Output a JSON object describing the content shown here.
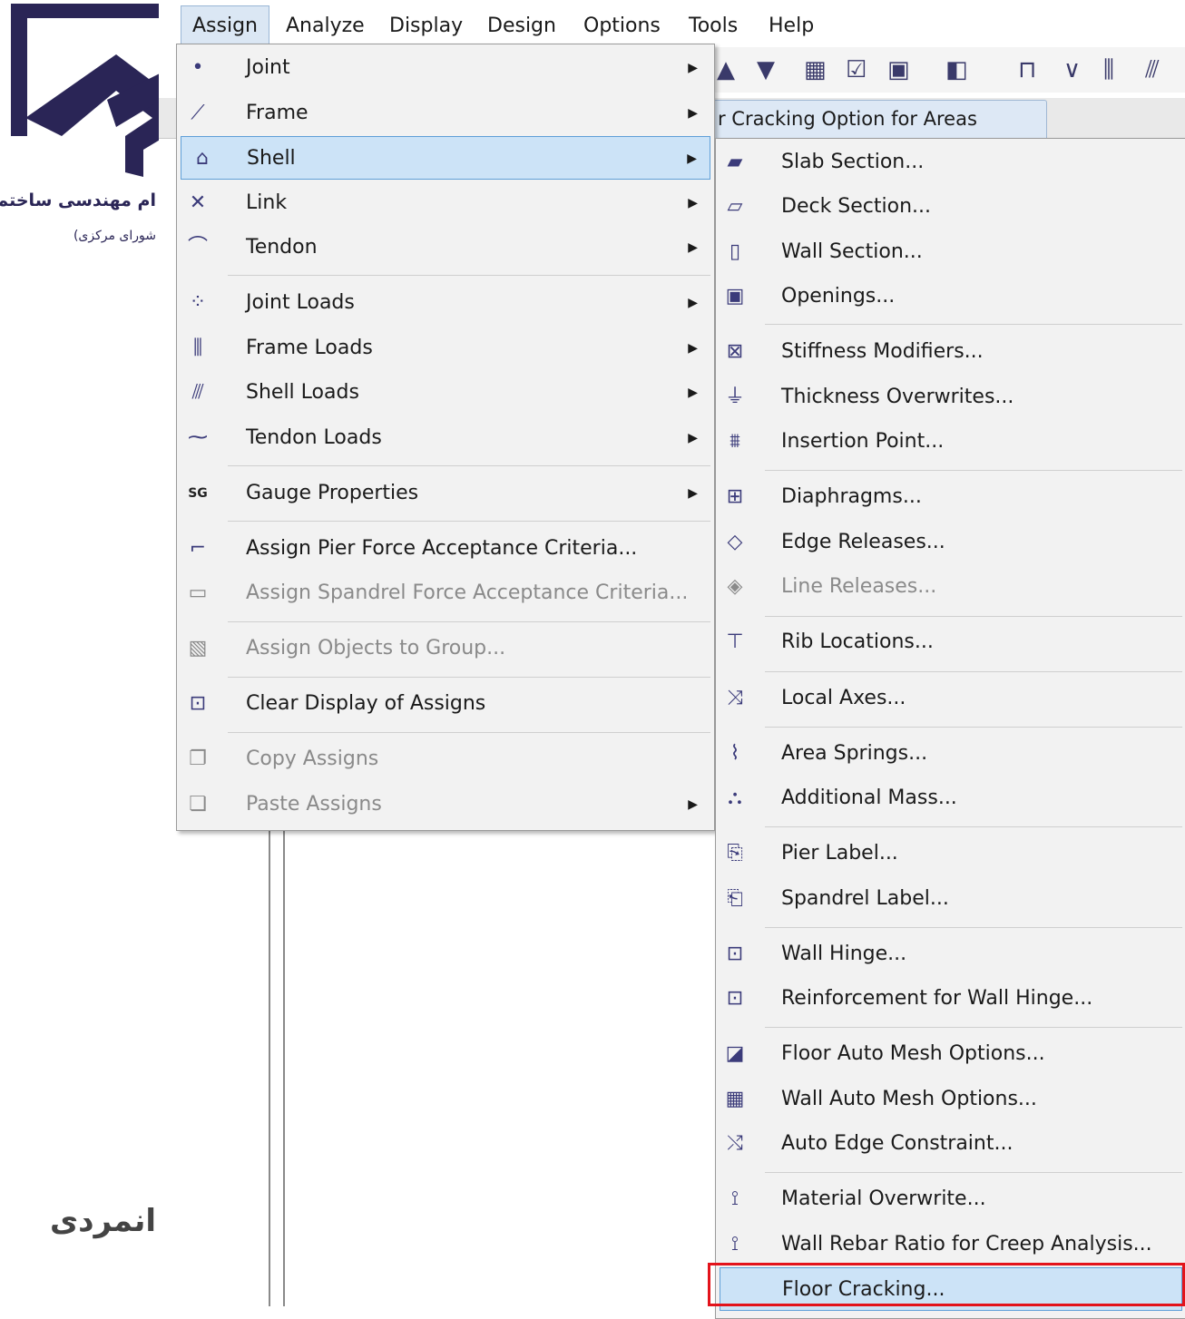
{
  "watermark": {
    "org_line1": "ام مهندسی ساختمان",
    "org_line2": "شورای مرکزی)",
    "author": "انمردی"
  },
  "menubar": {
    "items": [
      "Assign",
      "Analyze",
      "Display",
      "Design",
      "Options",
      "Tools",
      "Help"
    ],
    "active": "Assign"
  },
  "tab": {
    "label": "r Cracking Option for Areas"
  },
  "assign_menu": {
    "items": [
      {
        "label": "Joint",
        "icon": "joint-icon",
        "submenu": true
      },
      {
        "label": "Frame",
        "icon": "frame-icon",
        "submenu": true
      },
      {
        "label": "Shell",
        "icon": "shell-icon",
        "submenu": true,
        "highlighted": true
      },
      {
        "label": "Link",
        "icon": "link-icon",
        "submenu": true
      },
      {
        "label": "Tendon",
        "icon": "tendon-icon",
        "submenu": true
      },
      {
        "label": "Joint Loads",
        "icon": "joint-loads-icon",
        "submenu": true
      },
      {
        "label": "Frame Loads",
        "icon": "frame-loads-icon",
        "submenu": true
      },
      {
        "label": "Shell Loads",
        "icon": "shell-loads-icon",
        "submenu": true
      },
      {
        "label": "Tendon Loads",
        "icon": "tendon-loads-icon",
        "submenu": true
      },
      {
        "label": "Gauge Properties",
        "icon": "gauge-icon",
        "submenu": true
      },
      {
        "label": "Assign Pier Force Acceptance Criteria...",
        "icon": "pier-force-icon"
      },
      {
        "label": "Assign Spandrel Force Acceptance Criteria...",
        "icon": "spandrel-force-icon",
        "disabled": true
      },
      {
        "label": "Assign Objects to Group...",
        "icon": "group-icon",
        "disabled": true
      },
      {
        "label": "Clear Display of Assigns",
        "icon": "clear-display-icon"
      },
      {
        "label": "Copy Assigns",
        "icon": "copy-icon",
        "disabled": true
      },
      {
        "label": "Paste Assigns",
        "icon": "paste-icon",
        "disabled": true,
        "submenu": true
      }
    ]
  },
  "shell_menu": {
    "items": [
      {
        "label": "Slab Section...",
        "icon": "slab-section-icon"
      },
      {
        "label": "Deck Section...",
        "icon": "deck-section-icon"
      },
      {
        "label": "Wall Section...",
        "icon": "wall-section-icon"
      },
      {
        "label": "Openings...",
        "icon": "openings-icon"
      },
      {
        "label": "Stiffness Modifiers...",
        "icon": "stiffness-icon"
      },
      {
        "label": "Thickness Overwrites...",
        "icon": "thickness-icon"
      },
      {
        "label": "Insertion Point...",
        "icon": "insertion-point-icon"
      },
      {
        "label": "Diaphragms...",
        "icon": "diaphragm-icon"
      },
      {
        "label": "Edge Releases...",
        "icon": "edge-release-icon"
      },
      {
        "label": "Line Releases...",
        "icon": "line-release-icon",
        "disabled": true
      },
      {
        "label": "Rib Locations...",
        "icon": "rib-icon"
      },
      {
        "label": "Local Axes...",
        "icon": "local-axes-icon"
      },
      {
        "label": "Area Springs...",
        "icon": "area-springs-icon"
      },
      {
        "label": "Additional Mass...",
        "icon": "mass-icon"
      },
      {
        "label": "Pier Label...",
        "icon": "pier-label-icon"
      },
      {
        "label": "Spandrel Label...",
        "icon": "spandrel-label-icon"
      },
      {
        "label": "Wall Hinge...",
        "icon": "wall-hinge-icon"
      },
      {
        "label": "Reinforcement for Wall Hinge...",
        "icon": "reinforcement-icon"
      },
      {
        "label": "Floor Auto Mesh Options...",
        "icon": "floor-mesh-icon"
      },
      {
        "label": "Wall Auto Mesh Options...",
        "icon": "wall-mesh-icon"
      },
      {
        "label": "Auto Edge Constraint...",
        "icon": "edge-constraint-icon"
      },
      {
        "label": "Material Overwrite...",
        "icon": "material-icon"
      },
      {
        "label": "Wall Rebar Ratio for Creep Analysis...",
        "icon": "rebar-ratio-icon"
      },
      {
        "label": "Floor Cracking...",
        "icon": "floor-cracking-icon",
        "highlighted": true
      }
    ]
  },
  "colors": {
    "highlight": "#cce3f7",
    "highlight_border": "#5f9fd8",
    "annotation": "#e3131b",
    "logo": "#2a2556"
  }
}
